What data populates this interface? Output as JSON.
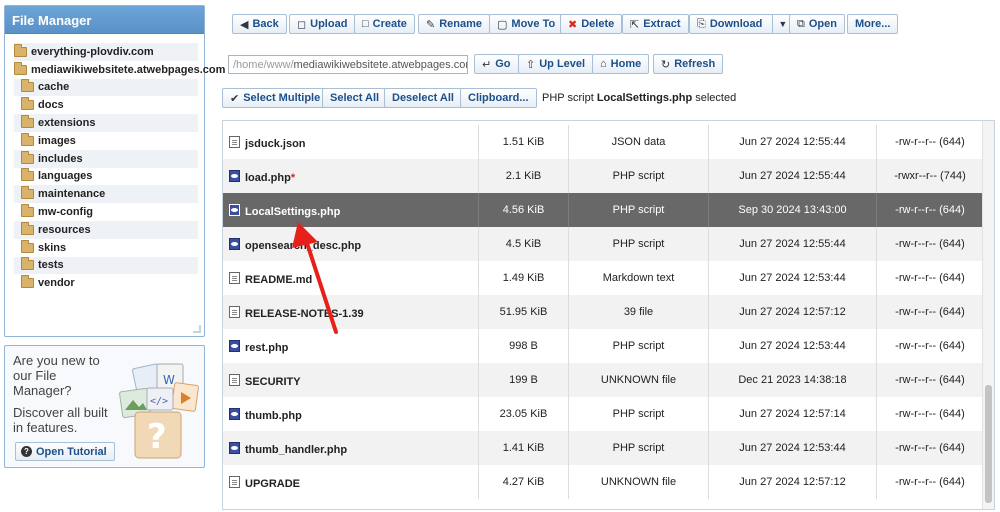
{
  "file_manager": {
    "title": "File Manager",
    "tree": [
      {
        "label": "everything-plovdiv.com",
        "level": 0
      },
      {
        "label": "mediawikiwebsitete.atwebpages.com",
        "level": 0
      },
      {
        "label": "cache",
        "level": 1
      },
      {
        "label": "docs",
        "level": 1
      },
      {
        "label": "extensions",
        "level": 1
      },
      {
        "label": "images",
        "level": 1
      },
      {
        "label": "includes",
        "level": 1
      },
      {
        "label": "languages",
        "level": 1
      },
      {
        "label": "maintenance",
        "level": 1
      },
      {
        "label": "mw-config",
        "level": 1
      },
      {
        "label": "resources",
        "level": 1
      },
      {
        "label": "skins",
        "level": 1
      },
      {
        "label": "tests",
        "level": 1
      },
      {
        "label": "vendor",
        "level": 1
      }
    ]
  },
  "promo": {
    "question": "Are you new to our File Manager?",
    "discover": "Discover all built in features.",
    "tutorial_label": "Open Tutorial"
  },
  "toolbar": {
    "back": "Back",
    "upload": "Upload",
    "create": "Create",
    "rename": "Rename",
    "move_to": "Move To",
    "delete": "Delete",
    "extract": "Extract",
    "download": "Download",
    "open": "Open",
    "more": "More..."
  },
  "path": {
    "prefix": "/home/www/",
    "value": "mediawikiwebsitete.atwebpages.com",
    "go": "Go",
    "up_level": "Up Level",
    "home": "Home",
    "refresh": "Refresh"
  },
  "selection": {
    "select_multiple": "Select Multiple",
    "select_all": "Select All",
    "deselect_all": "Deselect All",
    "clipboard": "Clipboard...",
    "status_prefix": "PHP script",
    "status_file": "LocalSettings.php",
    "status_suffix": "selected"
  },
  "files": [
    {
      "name": "jsduck.json",
      "modified_mark": "",
      "size": "1.51 KiB",
      "type": "JSON data",
      "date": "Jun 27 2024 12:55:44",
      "perms": "-rw-r--r-- (644)",
      "icon": "file"
    },
    {
      "name": "load.php",
      "modified_mark": "*",
      "size": "2.1 KiB",
      "type": "PHP script",
      "date": "Jun 27 2024 12:55:44",
      "perms": "-rwxr--r-- (744)",
      "icon": "php"
    },
    {
      "name": "LocalSettings.php",
      "modified_mark": "",
      "size": "4.56 KiB",
      "type": "PHP script",
      "date": "Sep 30 2024 13:43:00",
      "perms": "-rw-r--r-- (644)",
      "icon": "php"
    },
    {
      "name": "opensearch_desc.php",
      "modified_mark": "",
      "size": "4.5 KiB",
      "type": "PHP script",
      "date": "Jun 27 2024 12:55:44",
      "perms": "-rw-r--r-- (644)",
      "icon": "php"
    },
    {
      "name": "README.md",
      "modified_mark": "",
      "size": "1.49 KiB",
      "type": "Markdown text",
      "date": "Jun 27 2024 12:53:44",
      "perms": "-rw-r--r-- (644)",
      "icon": "file"
    },
    {
      "name": "RELEASE-NOTES-1.39",
      "modified_mark": "",
      "size": "51.95 KiB",
      "type": "39 file",
      "date": "Jun 27 2024 12:57:12",
      "perms": "-rw-r--r-- (644)",
      "icon": "file"
    },
    {
      "name": "rest.php",
      "modified_mark": "",
      "size": "998 B",
      "type": "PHP script",
      "date": "Jun 27 2024 12:53:44",
      "perms": "-rw-r--r-- (644)",
      "icon": "php"
    },
    {
      "name": "SECURITY",
      "modified_mark": "",
      "size": "199 B",
      "type": "UNKNOWN file",
      "date": "Dec 21 2023 14:38:18",
      "perms": "-rw-r--r-- (644)",
      "icon": "file"
    },
    {
      "name": "thumb.php",
      "modified_mark": "",
      "size": "23.05 KiB",
      "type": "PHP script",
      "date": "Jun 27 2024 12:57:14",
      "perms": "-rw-r--r-- (644)",
      "icon": "php"
    },
    {
      "name": "thumb_handler.php",
      "modified_mark": "",
      "size": "1.41 KiB",
      "type": "PHP script",
      "date": "Jun 27 2024 12:53:44",
      "perms": "-rw-r--r-- (644)",
      "icon": "php"
    },
    {
      "name": "UPGRADE",
      "modified_mark": "",
      "size": "4.27 KiB",
      "type": "UNKNOWN file",
      "date": "Jun 27 2024 12:57:12",
      "perms": "-rw-r--r-- (644)",
      "icon": "file"
    }
  ],
  "selected_index": 2,
  "colors": {
    "accent": "#1d4f8a",
    "header": "#5a92c8",
    "selected_row": "#686868",
    "annotation": "#e8201a"
  }
}
